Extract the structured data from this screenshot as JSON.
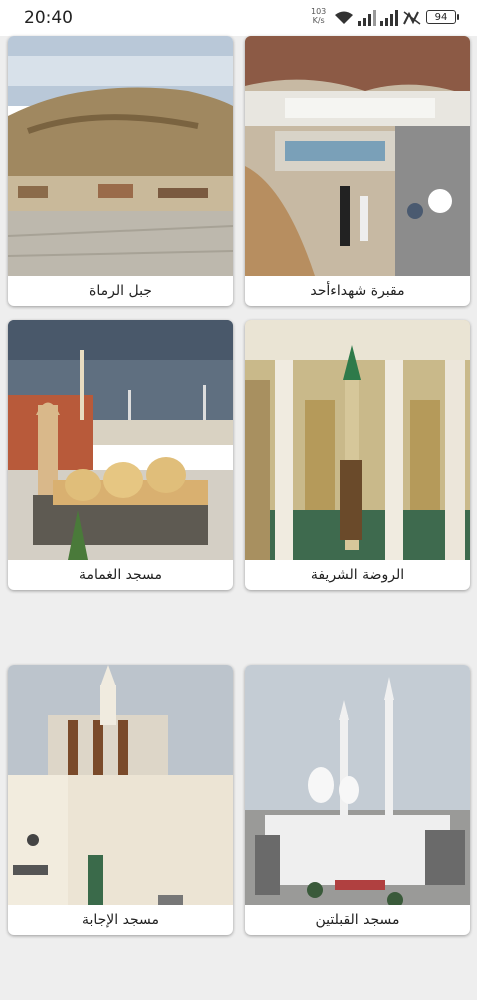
{
  "status": {
    "time": "20:40",
    "speed_value": "103",
    "speed_unit": "K/s",
    "battery": "94"
  },
  "places": [
    {
      "label": "جبل الرماة",
      "image": "mountain-photo"
    },
    {
      "label": "مقبرة شهداءأحد",
      "image": "cemetery-photo"
    },
    {
      "label": "مسجد الغمامة",
      "image": "mosque-photo"
    },
    {
      "label": "الروضة الشريفة",
      "image": "interior-photo"
    },
    {
      "label": "مسجد الإجابة",
      "image": "mosque-photo"
    },
    {
      "label": "مسجد القبلتين",
      "image": "mosque-photo"
    }
  ]
}
